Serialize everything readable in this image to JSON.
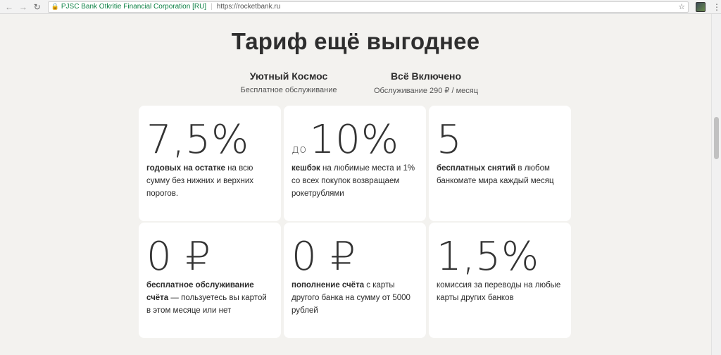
{
  "browser": {
    "org_label": "PJSC Bank Otkritie Financial Corporation [RU]",
    "url": "https://rocketbank.ru"
  },
  "page": {
    "title": "Тариф ещё выгоднее",
    "tariffs": [
      {
        "name": "Уютный Космос",
        "subtitle": "Бесплатное обслуживание"
      },
      {
        "name": "Всё Включено",
        "subtitle": "Обслуживание 290 ₽ / месяц"
      }
    ],
    "cards": [
      {
        "prefix": "",
        "value": "7,5%",
        "bold": "годовых на остатке",
        "text": " на всю сумму без нижних и верхних порогов."
      },
      {
        "prefix": "до",
        "value": "10%",
        "bold": "кешбэк",
        "text": " на любимые места и 1% со всех покупок возвращаем рокетрублями"
      },
      {
        "prefix": "",
        "value": "5",
        "bold": "бесплатных снятий",
        "text": " в любом банкомате мира каждый месяц"
      },
      {
        "prefix": "",
        "value": "0 ₽",
        "bold": "бесплатное обслуживание счёта",
        "text": " — пользуетесь вы картой в этом месяце или нет"
      },
      {
        "prefix": "",
        "value": "0 ₽",
        "bold": "пополнение счёта",
        "text": " с карты другого банка на сумму от 5000 рублей"
      },
      {
        "prefix": "",
        "value": "1,5%",
        "bold": "",
        "text": "комиссия за переводы на любые карты других банков"
      }
    ]
  }
}
